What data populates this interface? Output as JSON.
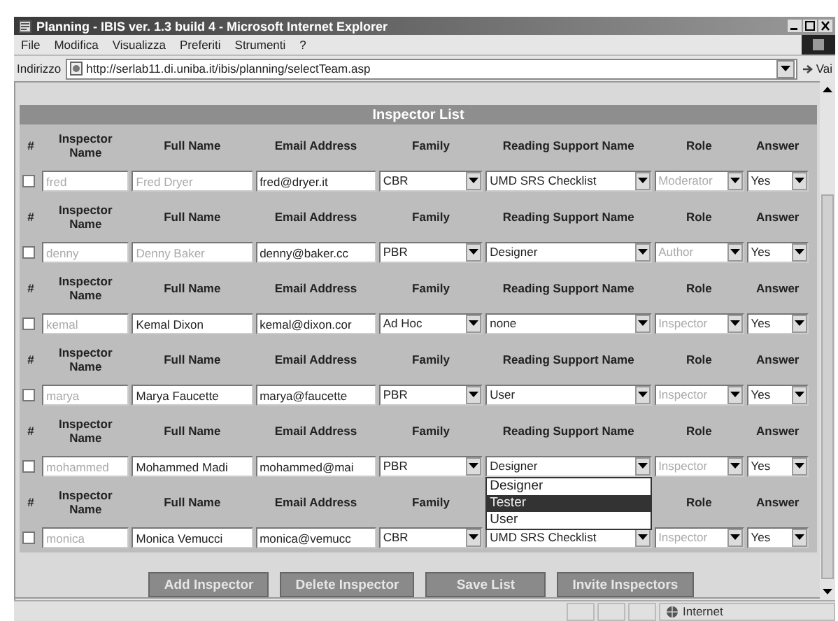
{
  "window": {
    "title": "Planning - IBIS ver. 1.3 build 4 - Microsoft Internet Explorer"
  },
  "menu": [
    "File",
    "Modifica",
    "Visualizza",
    "Preferiti",
    "Strumenti",
    "?"
  ],
  "address_bar": {
    "label": "Indirizzo",
    "url": "http://serlab11.di.uniba.it/ibis/planning/selectTeam.asp",
    "go": "Vai"
  },
  "table": {
    "title": "Inspector List",
    "groups": [
      {
        "headings": {
          "number": "#",
          "inspector_name": "Inspector Name",
          "full_name": "Full Name",
          "email": "Email Address",
          "family": "Family",
          "reading_support": "Reading Support Name",
          "role": "Role",
          "answer": "Answer"
        },
        "row": {
          "checked": false,
          "inspector_name": {
            "value": "fred",
            "disabled": true
          },
          "full_name": {
            "value": "Fred Dryer",
            "disabled": true
          },
          "email": "fred@dryer.it",
          "family": "CBR",
          "reading_support": "UMD SRS Checklist",
          "role": {
            "value": "Moderator",
            "disabled": true
          },
          "answer": "Yes"
        }
      },
      {
        "headings": {
          "number": "#",
          "inspector_name": "Inspector Name",
          "full_name": "Full Name",
          "email": "Email Address",
          "family": "Family",
          "reading_support": "Reading Support Name",
          "role": "Role",
          "answer": "Answer"
        },
        "row": {
          "checked": false,
          "inspector_name": {
            "value": "denny",
            "disabled": true
          },
          "full_name": {
            "value": "Denny Baker",
            "disabled": true
          },
          "email": "denny@baker.cc",
          "family": "PBR",
          "reading_support": "Designer",
          "role": {
            "value": "Author",
            "disabled": true
          },
          "answer": "Yes"
        }
      },
      {
        "headings": {
          "number": "#",
          "inspector_name": "Inspector Name",
          "full_name": "Full Name",
          "email": "Email Address",
          "family": "Family",
          "reading_support": "Reading Support Name",
          "role": "Role",
          "answer": "Answer"
        },
        "row": {
          "checked": false,
          "inspector_name": {
            "value": "kemal",
            "disabled": true
          },
          "full_name": {
            "value": "Kemal Dixon",
            "disabled": false
          },
          "email": "kemal@dixon.cor",
          "family": "Ad Hoc",
          "reading_support": "none",
          "role": {
            "value": "Inspector",
            "disabled": true
          },
          "answer": "Yes"
        }
      },
      {
        "headings": {
          "number": "#",
          "inspector_name": "Inspector Name",
          "full_name": "Full Name",
          "email": "Email Address",
          "family": "Family",
          "reading_support": "Reading Support Name",
          "role": "Role",
          "answer": "Answer"
        },
        "row": {
          "checked": false,
          "inspector_name": {
            "value": "marya",
            "disabled": true
          },
          "full_name": {
            "value": "Marya Faucette",
            "disabled": false
          },
          "email": "marya@faucette",
          "family": "PBR",
          "reading_support": "User",
          "role": {
            "value": "Inspector",
            "disabled": true
          },
          "answer": "Yes"
        }
      },
      {
        "headings": {
          "number": "#",
          "inspector_name": "Inspector Name",
          "full_name": "Full Name",
          "email": "Email Address",
          "family": "Family",
          "reading_support": "Reading Support Name",
          "role": "Role",
          "answer": "Answer"
        },
        "row": {
          "checked": false,
          "inspector_name": {
            "value": "mohammed",
            "disabled": true
          },
          "full_name": {
            "value": "Mohammed Madi",
            "disabled": false
          },
          "email": "mohammed@mai",
          "family": "PBR",
          "reading_support": "Designer",
          "role": {
            "value": "Inspector",
            "disabled": true
          },
          "answer": "Yes",
          "dropdown": [
            {
              "label": "Designer",
              "selected": false
            },
            {
              "label": "Tester",
              "selected": true
            },
            {
              "label": "User",
              "selected": false
            }
          ]
        }
      },
      {
        "headings": {
          "number": "#",
          "inspector_name": "Inspector Name",
          "full_name": "Full Name",
          "email": "Email Address",
          "family": "Family",
          "role": "Role",
          "answer": "Answer"
        },
        "row": {
          "checked": false,
          "inspector_name": {
            "value": "monica",
            "disabled": true
          },
          "full_name": {
            "value": "Monica Vemucci",
            "disabled": false
          },
          "email": "monica@vemucc",
          "family": "CBR",
          "reading_support": "UMD SRS Checklist",
          "role": {
            "value": "Inspector",
            "disabled": true
          },
          "answer": "Yes"
        }
      }
    ]
  },
  "buttons": [
    "Add Inspector",
    "Delete Inspector",
    "Save List",
    "Invite Inspectors"
  ],
  "status_bar": {
    "zone": "Internet"
  }
}
